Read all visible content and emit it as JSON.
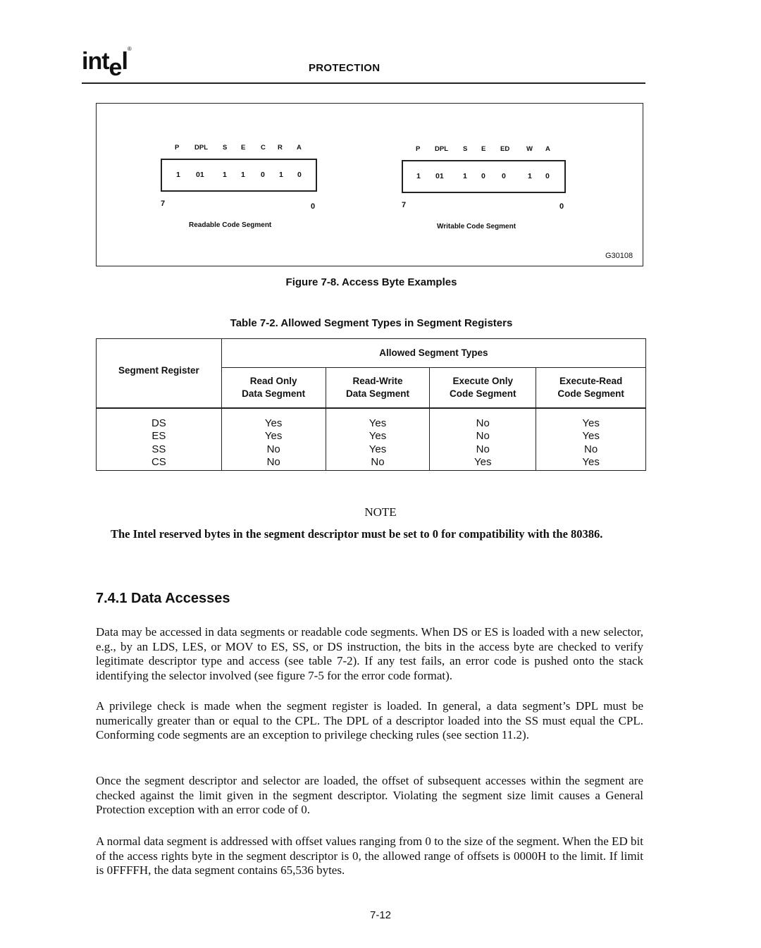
{
  "header": {
    "logo": "int",
    "logo_e": "e",
    "logo_l": "l",
    "logo_reg": "®",
    "title": "PROTECTION"
  },
  "figure": {
    "id": "G30108",
    "caption": "Figure 7-8.  Access Byte Examples",
    "left": {
      "fields": [
        "P",
        "DPL",
        "S",
        "E",
        "C",
        "R",
        "A"
      ],
      "bits": [
        "1",
        "01",
        "1",
        "1",
        "0",
        "1",
        "0"
      ],
      "msb_label": "7",
      "lsb_label": "0",
      "label": "Readable Code Segment"
    },
    "right": {
      "fields": [
        "P",
        "DPL",
        "S",
        "E",
        "ED",
        "W",
        "A"
      ],
      "bits": [
        "1",
        "01",
        "1",
        "0",
        "0",
        "1",
        "0"
      ],
      "msb_label": "7",
      "lsb_label": "0",
      "label": "Writable Code Segment"
    }
  },
  "table": {
    "caption": "Table 7-2.  Allowed Segment Types in Segment Registers",
    "row_header": "Segment Register",
    "group_header": "Allowed Segment Types",
    "columns": [
      {
        "line1": "Read Only",
        "line2": "Data Segment"
      },
      {
        "line1": "Read-Write",
        "line2": "Data Segment"
      },
      {
        "line1": "Execute Only",
        "line2": "Code Segment"
      },
      {
        "line1": "Execute-Read",
        "line2": "Code Segment"
      }
    ],
    "rows": [
      {
        "register": "DS",
        "values": [
          "Yes",
          "Yes",
          "No",
          "Yes"
        ]
      },
      {
        "register": "ES",
        "values": [
          "Yes",
          "Yes",
          "No",
          "Yes"
        ]
      },
      {
        "register": "SS",
        "values": [
          "No",
          "Yes",
          "No",
          "No"
        ]
      },
      {
        "register": "CS",
        "values": [
          "No",
          "No",
          "Yes",
          "Yes"
        ]
      }
    ]
  },
  "note": {
    "title": "NOTE",
    "text": "The Intel reserved bytes in the segment descriptor must be set to 0 for compatibility with the 80386."
  },
  "section": {
    "heading": "7.4.1  Data Accesses",
    "paragraphs": [
      "Data may be accessed in data segments or readable code segments. When DS or ES is loaded with a new selector, e.g., by an LDS, LES, or MOV to ES, SS, or DS instruction, the bits in the access byte are checked to verify legitimate descriptor type and access (see table 7-2). If any test fails, an error code is pushed onto the stack identifying the selector involved (see figure 7-5 for the error code format).",
      "A privilege check is made when the segment register is loaded. In general, a data segment’s DPL must be numerically greater than or equal to the CPL. The DPL of a descriptor loaded into the SS must equal the CPL. Conforming code segments are an exception to privilege checking rules (see section 11.2).",
      "Once the segment descriptor and selector are loaded, the offset of subsequent accesses within the segment are checked against the limit given in the segment descriptor. Violating the segment size limit causes a General Protection exception with an error code of 0.",
      "A normal data segment is addressed with offset values ranging from 0 to the size of the segment. When the ED bit of the access rights byte in the segment descriptor is 0, the allowed range of offsets is 0000H to the limit. If limit is 0FFFFH, the data segment contains 65,536 bytes."
    ]
  },
  "footer": {
    "page_number": "7-12"
  }
}
